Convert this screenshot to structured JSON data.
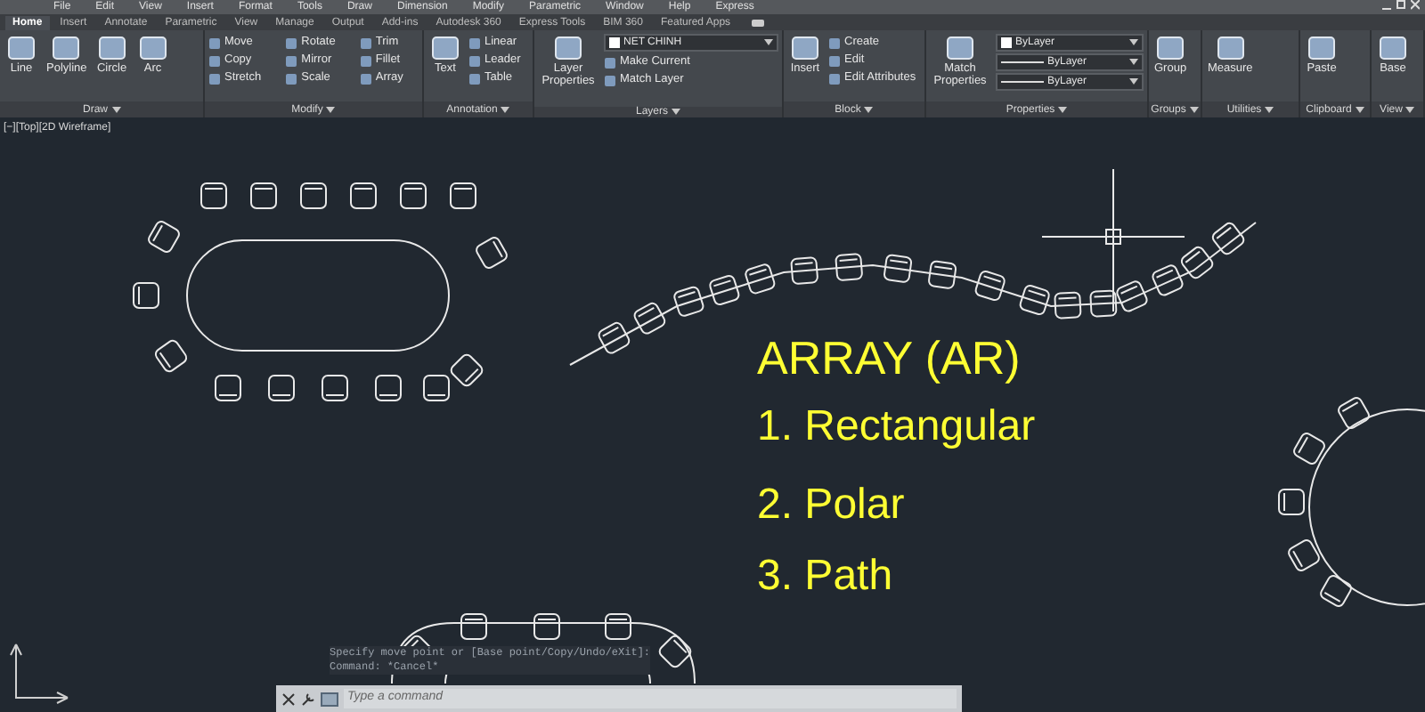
{
  "menu_bar": [
    "File",
    "Edit",
    "View",
    "Insert",
    "Format",
    "Tools",
    "Draw",
    "Dimension",
    "Modify",
    "Parametric",
    "Window",
    "Help",
    "Express"
  ],
  "tabs": [
    {
      "label": "Home",
      "selected": true
    },
    {
      "label": "Insert",
      "selected": false
    },
    {
      "label": "Annotate",
      "selected": false
    },
    {
      "label": "Parametric",
      "selected": false
    },
    {
      "label": "View",
      "selected": false
    },
    {
      "label": "Manage",
      "selected": false
    },
    {
      "label": "Output",
      "selected": false
    },
    {
      "label": "Add-ins",
      "selected": false
    },
    {
      "label": "Autodesk 360",
      "selected": false
    },
    {
      "label": "Express Tools",
      "selected": false
    },
    {
      "label": "BIM 360",
      "selected": false
    },
    {
      "label": "Featured Apps",
      "selected": false
    }
  ],
  "ribbon_panels": [
    {
      "title": "Draw",
      "large_tools": [
        "Line",
        "Polyline",
        "Circle",
        "Arc"
      ]
    },
    {
      "title": "Modify",
      "small_tools": [
        "Move",
        "Copy",
        "Stretch",
        "Rotate",
        "Mirror",
        "Scale",
        "Trim",
        "Fillet",
        "Array"
      ]
    },
    {
      "title": "Annotation",
      "large_tools": [
        "Text"
      ],
      "small_tools": [
        "Linear",
        "Leader",
        "Table"
      ]
    },
    {
      "title": "Layers",
      "large_tools": [
        "Layer Properties"
      ],
      "dropdowns": [
        {
          "kind": "swatch",
          "value": "NET CHINH"
        }
      ],
      "small_tools": [
        "Make Current",
        "Match Layer"
      ]
    },
    {
      "title": "Block",
      "large_tools": [
        "Insert"
      ],
      "small_tools": [
        "Create",
        "Edit",
        "Edit Attributes"
      ]
    },
    {
      "title": "Properties",
      "large_tools": [
        "Match Properties"
      ],
      "dropdowns": [
        {
          "kind": "swatch",
          "value": "ByLayer"
        },
        {
          "kind": "line",
          "value": "ByLayer"
        },
        {
          "kind": "line",
          "value": "ByLayer"
        }
      ]
    },
    {
      "title": "Groups",
      "large_tools": [
        "Group"
      ]
    },
    {
      "title": "Utilities",
      "large_tools": [
        "Measure"
      ]
    },
    {
      "title": "Clipboard",
      "large_tools": [
        "Paste"
      ]
    },
    {
      "title": "View",
      "large_tools": [
        "Base"
      ]
    }
  ],
  "viewport": {
    "label": "[−][Top][2D Wireframe]",
    "annotations": [
      "ARRAY (AR)",
      "1. Rectangular",
      "2. Polar",
      "3. Path"
    ]
  },
  "command_line": {
    "history": [
      "Specify move point or [Base point/Copy/Undo/eXit]:",
      "Command: *Cancel*"
    ],
    "placeholder": "Type a command"
  }
}
